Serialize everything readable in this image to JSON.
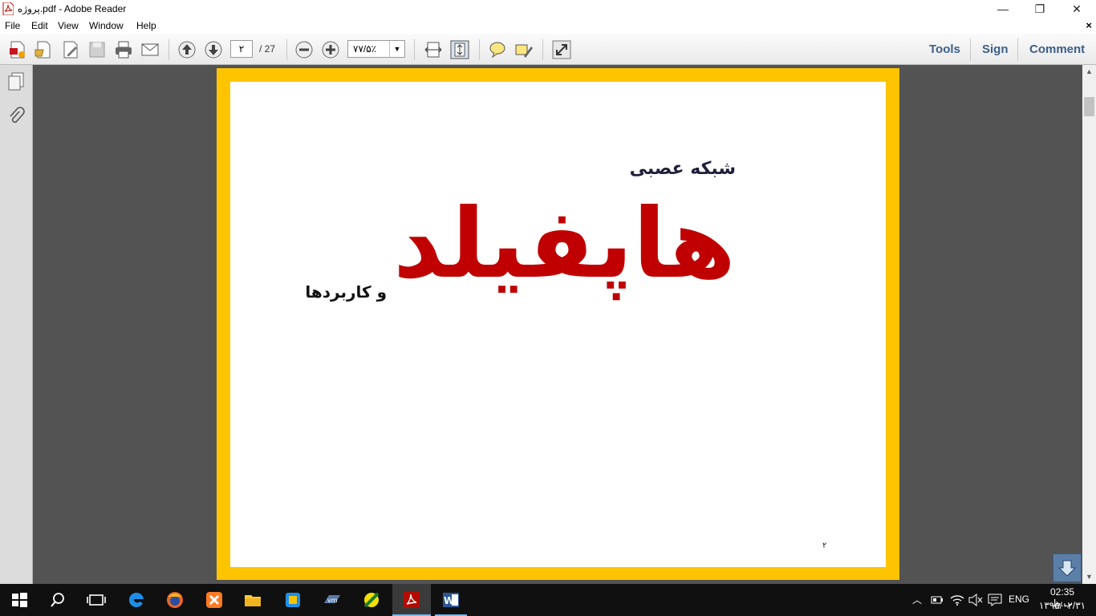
{
  "window": {
    "title": "پروژه.pdf - Adobe Reader",
    "minimize": "—",
    "restore": "❐",
    "close": "✕"
  },
  "menu": {
    "items": [
      "File",
      "Edit",
      "View",
      "Window",
      "Help"
    ],
    "close_doc": "×"
  },
  "toolbar": {
    "page_current": "۲",
    "page_total": "/ 27",
    "zoom": "۷۷/۵٪",
    "tools_label": "Tools",
    "sign_label": "Sign",
    "comment_label": "Comment"
  },
  "slide": {
    "subtitle": "شبکه عصبی",
    "title": "هاپفیلد",
    "tail": "و کاربردها",
    "page_number": "۲"
  },
  "taskbar": {
    "language": "ENG",
    "time": "02:35 ب.ظ",
    "date": "۱۳۹۵/۰۲/۳۱"
  },
  "colors": {
    "slide_border": "#ffc400",
    "title_red": "#c00000",
    "link_blue": "#3c5f8a",
    "doc_bg": "#535353",
    "taskbar": "#101010"
  }
}
